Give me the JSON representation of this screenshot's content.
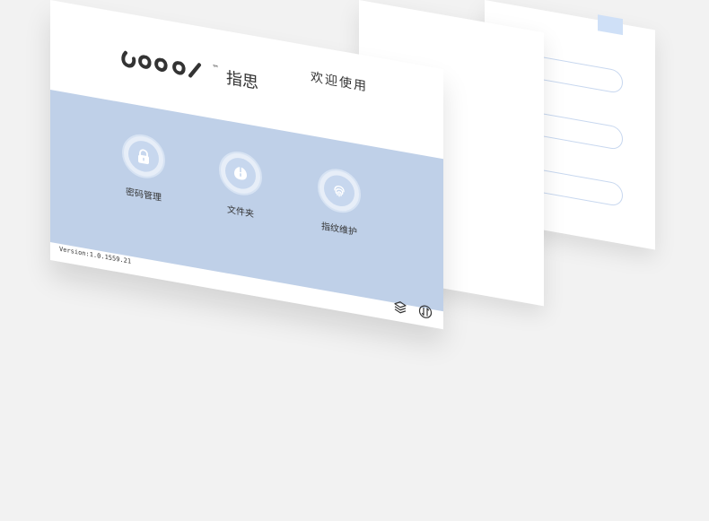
{
  "app": {
    "title": "指思",
    "welcome_text": "欢迎使用",
    "version": "Version:1.0.1559.21"
  },
  "features": [
    {
      "label": "密码管理",
      "icon": "lock-icon"
    },
    {
      "label": "文件夹",
      "icon": "mouse-icon"
    },
    {
      "label": "指纹维护",
      "icon": "fingerprint-icon"
    }
  ],
  "titlebar": {
    "minimize_icon": "minimize-icon",
    "close_icon": "close-icon"
  },
  "footer": {
    "layers_icon": "layers-icon",
    "sync_icon": "sync-icon"
  },
  "colors": {
    "background": "#f2f2f2",
    "band": "#bfd0e8",
    "accent_light": "#cfe0f7",
    "text": "#333333"
  }
}
